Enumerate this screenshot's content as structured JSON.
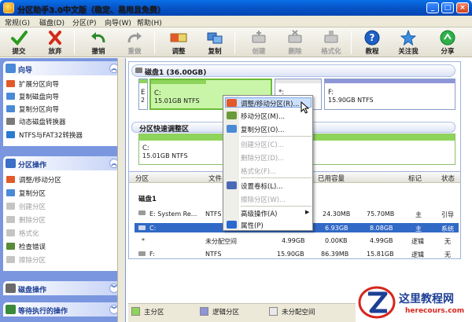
{
  "window": {
    "title": "分区助手3.0中文版（稳定、易用且免费）"
  },
  "menu": [
    "常规(G)",
    "磁盘(D)",
    "分区(P)",
    "向导(W)",
    "帮助(H)"
  ],
  "toolbar": {
    "submit": "提交",
    "discard": "放弃",
    "undo": "撤销",
    "redo": "重做",
    "adjust": "调整",
    "copy": "复制",
    "create": "创建",
    "delete": "删除",
    "format": "格式化",
    "tutorial": "教程",
    "follow": "关注我",
    "share": "分享"
  },
  "sidebar": {
    "wizard": {
      "title": "向导",
      "items": [
        "扩展分区向导",
        "复制磁盘向导",
        "复制分区向导",
        "动态磁盘转换器",
        "NTFS与FAT32转换器"
      ]
    },
    "partition_ops": {
      "title": "分区操作",
      "items": [
        "调整/移动分区",
        "复制分区",
        "创建分区",
        "删除分区",
        "格式化",
        "检查错误",
        "擦除分区"
      ]
    },
    "disk_ops": {
      "title": "磁盘操作"
    },
    "pending": {
      "title": "等待执行的操作"
    }
  },
  "disk": {
    "header": "磁盘1 (36.00GB)",
    "bar_e": {
      "name": "E",
      "info": "2"
    },
    "bar_c": {
      "name": "C:",
      "info": "15.01GB NTFS",
      "used_fraction": 0.46
    },
    "bar_star": {
      "name": "*:",
      "info": "4"
    },
    "bar_f": {
      "name": "F:",
      "info": "15.90GB NTFS"
    }
  },
  "section2": {
    "title": "分区快速调整区",
    "c_name": "C:",
    "c_info": "15.01GB NTFS"
  },
  "table": {
    "headers": [
      "分区",
      "文件",
      "已用容量",
      "标记",
      "状态"
    ],
    "disk_label": "磁盘1",
    "rows": [
      {
        "name": "E: System Re...",
        "fs": "NTFS",
        "used": "24.30MB",
        "unused": "75.70MB",
        "flag": "主",
        "status": "引导"
      },
      {
        "name": "C:",
        "fs": "",
        "used": "6.93GB",
        "unused": "8.08GB",
        "flag": "主",
        "status": "系统"
      },
      {
        "name": "*",
        "fs": "未分配空间",
        "capacity": "4.99GB",
        "used": "0.00KB",
        "unused": "4.99GB",
        "flag": "逻辑",
        "status": "无"
      },
      {
        "name": "F:",
        "fs": "NTFS",
        "capacity": "15.90GB",
        "used": "86.39MB",
        "unused": "15.81GB",
        "flag": "逻辑",
        "status": "无"
      }
    ]
  },
  "context_menu": {
    "items": [
      {
        "label": "调整/移动分区(R)...",
        "enabled": true
      },
      {
        "label": "移动分区(M)...",
        "enabled": true
      },
      {
        "label": "复制分区(O)...",
        "enabled": true
      },
      {
        "label": "创建分区(C)...",
        "enabled": false
      },
      {
        "label": "删除分区(D)...",
        "enabled": false
      },
      {
        "label": "格式化(F)...",
        "enabled": false
      },
      {
        "label": "设置卷标(L)...",
        "enabled": true
      },
      {
        "label": "擦除分区(W)...",
        "enabled": false
      },
      {
        "label": "高级操作(A)",
        "enabled": true
      },
      {
        "label": "属性(P)",
        "enabled": true
      }
    ]
  },
  "legend": {
    "primary": "主分区",
    "logical": "逻辑分区",
    "unallocated": "未分配空间"
  },
  "watermark": {
    "name": "这里教程网",
    "url": "herecours.com"
  },
  "colors": {
    "primary": "#8ed45a",
    "logical": "#8e95d8",
    "unallocated": "#e9e9e9",
    "accent": "#3169c6"
  }
}
